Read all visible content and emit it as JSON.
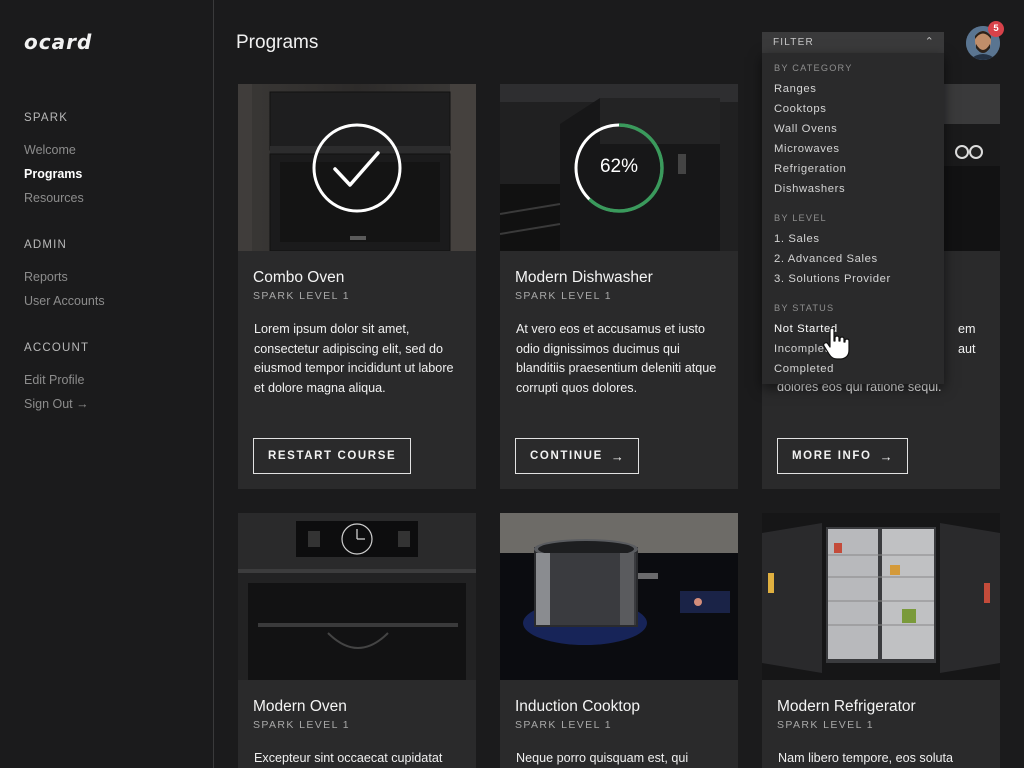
{
  "brand": {
    "logo_text": "ocard"
  },
  "header": {
    "title": "Programs",
    "notification_count": "5"
  },
  "sidebar": {
    "sections": [
      {
        "heading": "SPARK",
        "items": [
          "Welcome",
          "Programs",
          "Resources"
        ]
      },
      {
        "heading": "ADMIN",
        "items": [
          "Reports",
          "User Accounts"
        ]
      },
      {
        "heading": "ACCOUNT",
        "items": [
          "Edit Profile",
          "Sign Out →"
        ]
      }
    ],
    "active_item": "Programs"
  },
  "filter": {
    "label": "FILTER",
    "category": {
      "heading": "BY CATEGORY",
      "items": [
        "Ranges",
        "Cooktops",
        "Wall Ovens",
        "Microwaves",
        "Refrigeration",
        "Dishwashers"
      ]
    },
    "level": {
      "heading": "BY LEVEL",
      "items": [
        "1.  Sales",
        "2.  Advanced Sales",
        "3.  Solutions Provider"
      ]
    },
    "status": {
      "heading": "BY STATUS",
      "items": [
        "Not Started",
        "Incomplete",
        "Completed"
      ]
    },
    "hovered": "Not Started"
  },
  "cards": [
    {
      "title": "Combo Oven",
      "level": "SPARK LEVEL 1",
      "text": "Lorem ipsum dolor sit amet, consectetur adipiscing elit, sed do eiusmod tempor incididunt ut labore et dolore magna aliqua.",
      "button": "RESTART COURSE",
      "status": "completed"
    },
    {
      "title": "Modern Dishwasher",
      "level": "SPARK LEVEL 1",
      "text": "At vero eos et accusamus et iusto odio dignissimos ducimus qui blanditiis praesentium deleniti atque corrupti quos dolores.",
      "button": "CONTINUE",
      "progress": "62%"
    },
    {
      "title": "",
      "level": "",
      "text": "…em …aut dolores eos qui ratione sequi.",
      "button": "MORE INFO"
    },
    {
      "title": "Modern Oven",
      "level": "SPARK LEVEL 1",
      "text": "Excepteur sint occaecat cupidatat"
    },
    {
      "title": "Induction Cooktop",
      "level": "SPARK LEVEL 1",
      "text": "Neque porro quisquam est, qui"
    },
    {
      "title": "Modern Refrigerator",
      "level": "SPARK LEVEL 1",
      "text": "Nam libero tempore, eos soluta"
    }
  ],
  "colors": {
    "background": "#1b1b1c",
    "card": "#2a2a2b",
    "progress": "#3a9a5c",
    "badge": "#d8424a"
  },
  "icons": {
    "complete": "checkmark-circle-icon",
    "arrow": "arrow-right-icon",
    "filter_toggle": "chevron-up-icon",
    "cursor": "hand-pointer-icon"
  }
}
